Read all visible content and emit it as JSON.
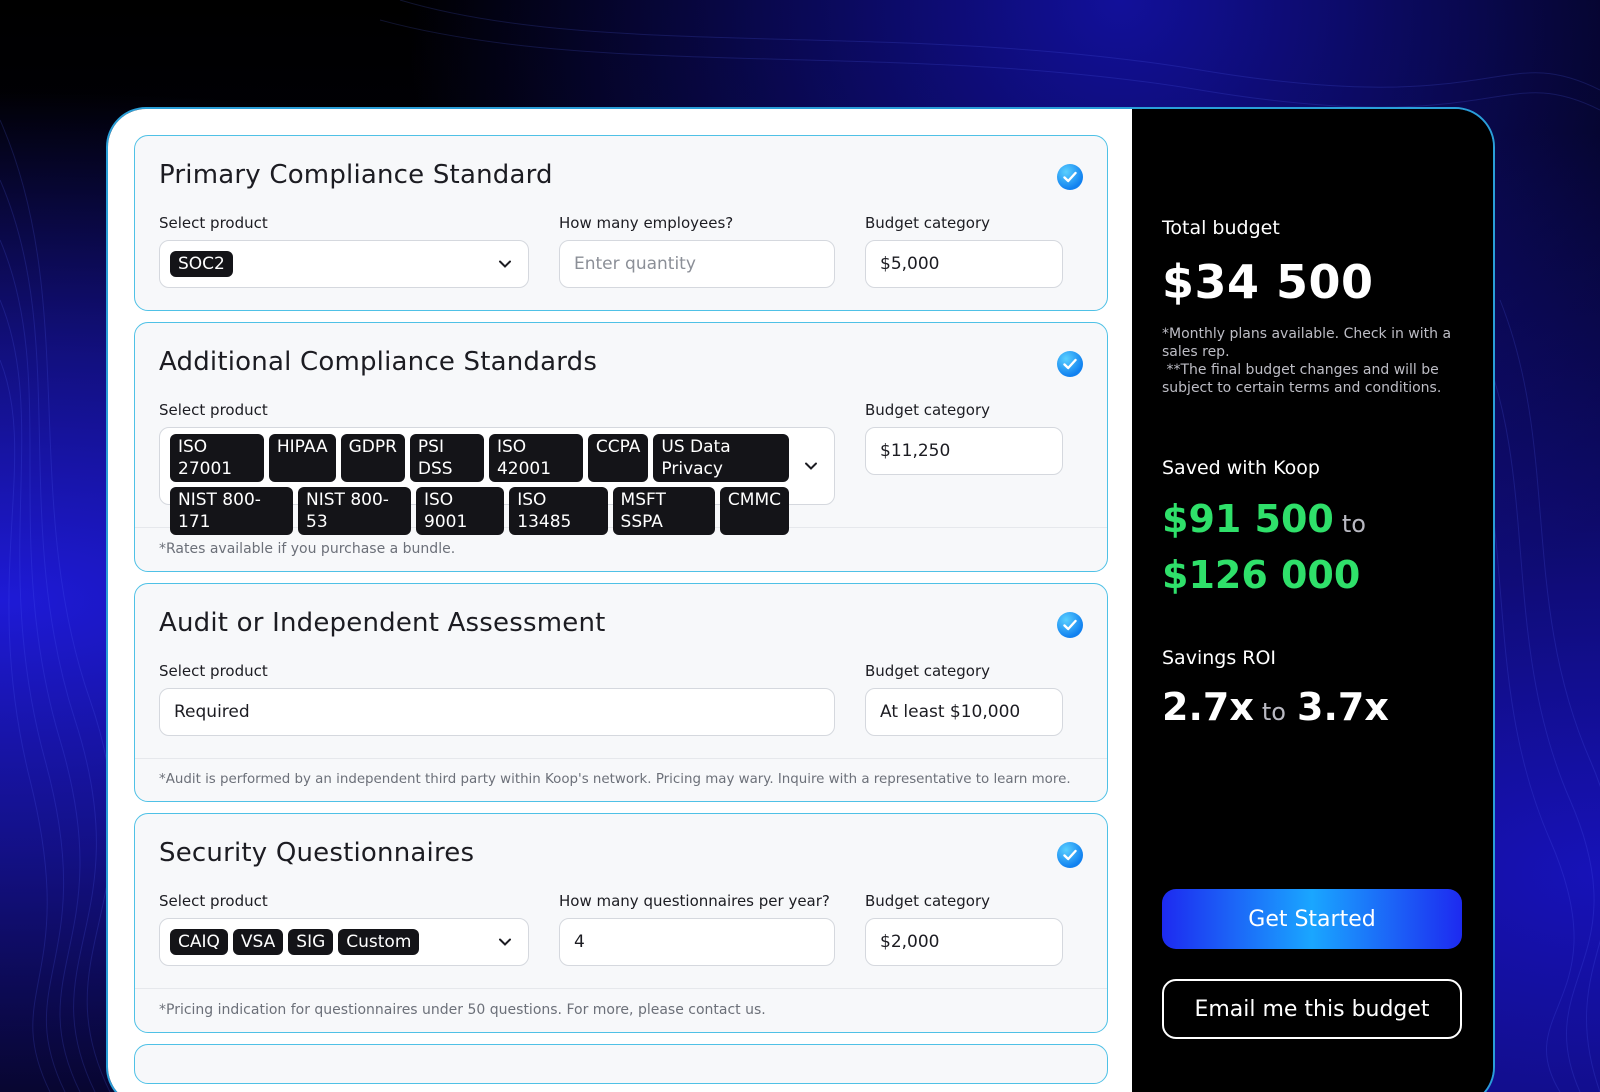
{
  "sections": [
    {
      "title": "Primary Compliance Standard",
      "product_label": "Select product",
      "product_tags": [
        "SOC2"
      ],
      "qty_label": "How many employees?",
      "qty_placeholder": "Enter quantity",
      "budget_label": "Budget category",
      "budget_value": "$5,000"
    },
    {
      "title": "Additional Compliance Standards",
      "product_label": "Select product",
      "tags_line1": [
        "ISO 27001",
        "HIPAA",
        "GDPR",
        "PSI DSS",
        "ISO 42001",
        "CCPA",
        "US Data Privacy"
      ],
      "tags_line2": [
        "NIST 800-171",
        "NIST 800-53",
        "ISO 9001",
        "ISO 13485",
        "MSFT SSPA",
        "CMMC"
      ],
      "budget_label": "Budget category",
      "budget_value": "$11,250",
      "note": "*Rates available if you purchase a bundle."
    },
    {
      "title": "Audit or Independent Assessment",
      "product_label": "Select product",
      "product_value": "Required",
      "budget_label": "Budget category",
      "budget_value": "At least $10,000",
      "note": "*Audit is performed by an independent third party within Koop's network. Pricing may wary. Inquire with a representative to learn more."
    },
    {
      "title": "Security Questionnaires",
      "product_label": "Select product",
      "product_tags": [
        "CAIQ",
        "VSA",
        "SIG",
        "Custom"
      ],
      "qty_label": "How many questionnaires per year?",
      "qty_value": "4",
      "budget_label": "Budget category",
      "budget_value": "$2,000",
      "note": "*Pricing indication for questionnaires under 50 questions. For more, please contact us."
    }
  ],
  "summary": {
    "total_label": "Total budget",
    "total_value": "$34 500",
    "note_line1": "*Monthly plans available. Check in with a sales rep.",
    "note_line2": " **The final budget changes and will be subject to certain terms and conditions.",
    "saved_label": "Saved with Koop",
    "saved_min": "$91 500",
    "saved_to": "to",
    "saved_max": "$126 000",
    "roi_label": "Savings ROI",
    "roi_min": "2.7x",
    "roi_to": "to",
    "roi_max": "3.7x"
  },
  "buttons": {
    "primary": "Get Started",
    "secondary": "Email me this budget"
  },
  "colors": {
    "accent_blue": "#1aa6ff",
    "savings_green": "#2fe06a",
    "section_border": "#4fc1e6"
  },
  "icons": {
    "section_check": "check-circle-icon",
    "dropdown": "chevron-down-icon"
  }
}
